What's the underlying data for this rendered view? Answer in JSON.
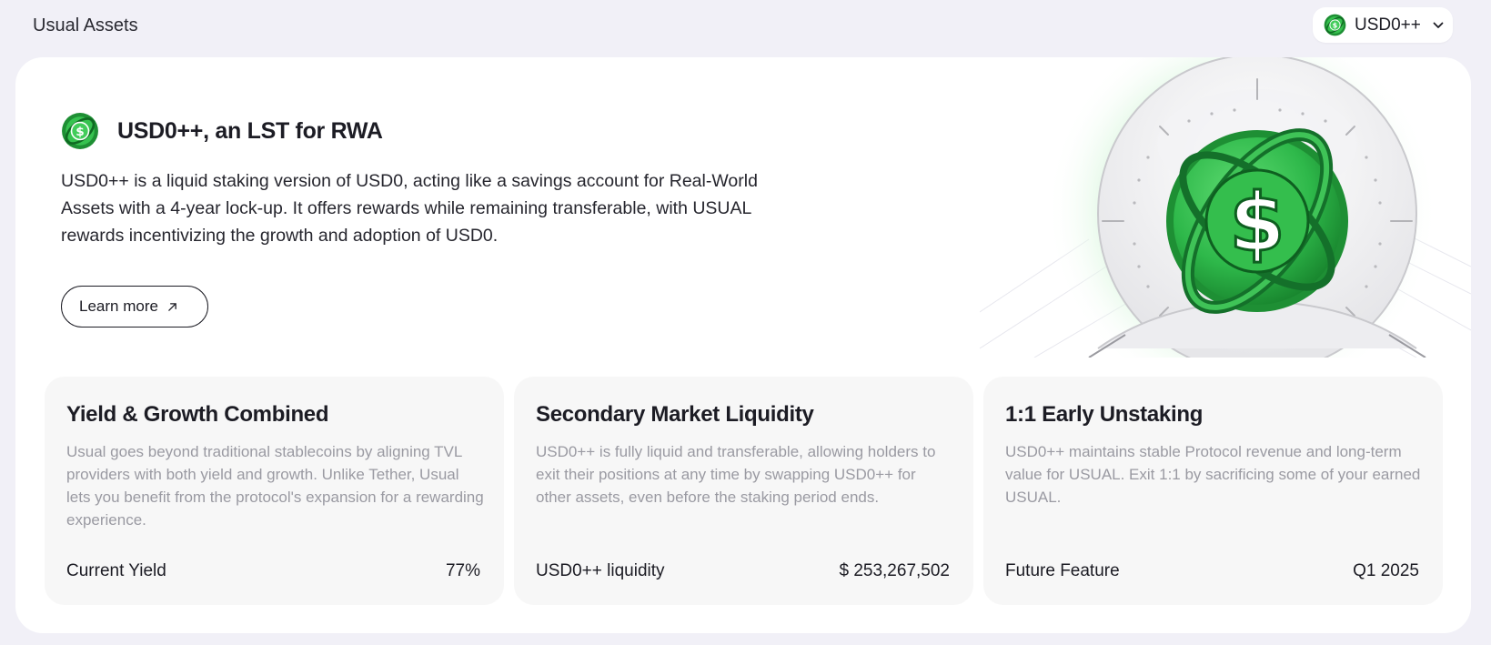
{
  "header": {
    "title": "Usual Assets",
    "asset_selector": {
      "selected": "USD0++",
      "icon": "usd0pp-coin-icon"
    }
  },
  "hero": {
    "icon": "usd0pp-coin-icon",
    "title": "USD0++, an LST for RWA",
    "description": "USD0++ is a liquid staking version of USD0, acting like a savings account for Real-World Assets with a 4-year lock-up. It offers rewards while remaining transferable, with USUAL rewards incentivizing the growth and adoption of USD0.",
    "learn_more": {
      "label": "Learn more",
      "icon": "external-arrow-icon"
    },
    "art": "dollar-globe-illustration"
  },
  "features": [
    {
      "title": "Yield & Growth Combined",
      "text": "Usual goes beyond traditional stablecoins by aligning TVL providers with both yield and growth. Unlike Tether, Usual lets you benefit from the protocol's expansion for a rewarding experience.",
      "label": "Current Yield",
      "value": "77%"
    },
    {
      "title": "Secondary Market Liquidity",
      "text": "USD0++ is fully liquid and transferable, allowing holders to exit their positions at any time by swapping USD0++ for other assets, even before the staking period ends.",
      "label": "USD0++ liquidity",
      "value": "$ 253,267,502"
    },
    {
      "title": "1:1 Early Unstaking",
      "text": "USD0++ maintains stable Protocol revenue and long-term value for USUAL. Exit 1:1 by sacrificing some of your earned USUAL.",
      "label": "Future Feature",
      "value": "Q1 2025"
    }
  ],
  "colors": {
    "background": "#f1f0f7",
    "card": "#ffffff",
    "feature_card": "#f7f7f7",
    "brand_green": "#2eb84a",
    "muted_text": "#9a9aa2"
  }
}
